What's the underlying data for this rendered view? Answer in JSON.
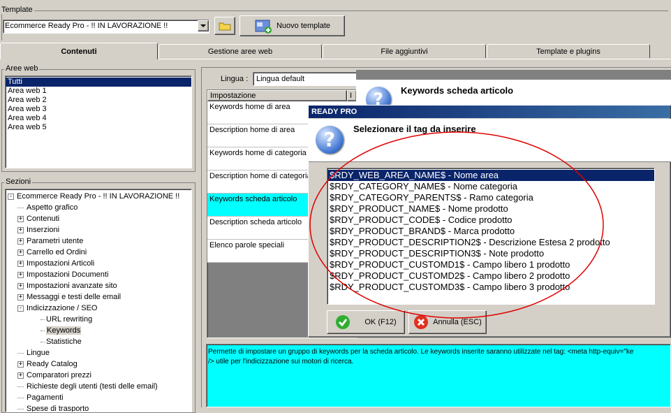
{
  "template_group": {
    "label": "Template",
    "selected": "Ecommerce Ready Pro - !! IN LAVORAZIONE !!",
    "new_button": "Nuovo template"
  },
  "tabs": [
    {
      "label": "Contenuti"
    },
    {
      "label": "Gestione aree web"
    },
    {
      "label": "File aggiuntivi"
    },
    {
      "label": "Template e plugins"
    }
  ],
  "aree_web": {
    "label": "Aree web",
    "items": [
      "Tutti",
      "Area web 1",
      "Area web 2",
      "Area web 3",
      "Area web 4",
      "Area web 5"
    ]
  },
  "sezioni": {
    "label": "Sezioni",
    "root": "Ecommerce Ready Pro - !! IN LAVORAZIONE !!",
    "items": [
      {
        "label": "Aspetto grafico",
        "expander": ""
      },
      {
        "label": "Contenuti",
        "expander": "+"
      },
      {
        "label": "Inserzioni",
        "expander": "+"
      },
      {
        "label": "Parametri utente",
        "expander": "+"
      },
      {
        "label": "Carrello ed Ordini",
        "expander": "+"
      },
      {
        "label": "Impostazioni Articoli",
        "expander": "+"
      },
      {
        "label": "Impostazioni Documenti",
        "expander": "+"
      },
      {
        "label": "Impostazioni avanzate sito",
        "expander": "+"
      },
      {
        "label": "Messaggi e testi delle email",
        "expander": "+"
      },
      {
        "label": "Indicizzazione / SEO",
        "expander": "-"
      },
      {
        "label": "URL rewriting",
        "expander": "child"
      },
      {
        "label": "Keywords",
        "expander": "child"
      },
      {
        "label": "Statistiche",
        "expander": "child"
      },
      {
        "label": "Lingue",
        "expander": ""
      },
      {
        "label": "Ready Catalog",
        "expander": "+"
      },
      {
        "label": "Comparatori prezzi",
        "expander": "+"
      },
      {
        "label": "Richieste degli utenti (testi delle email)",
        "expander": ""
      },
      {
        "label": "Pagamenti",
        "expander": ""
      },
      {
        "label": "Spese di trasporto",
        "expander": ""
      }
    ]
  },
  "main": {
    "lingua_label": "Lingua :",
    "lingua_value": "Lingua default",
    "grid_header": "Impostazione",
    "grid_header2": "I",
    "rows": [
      "Keywords home di area",
      "Description home di area",
      "Keywords home di categoria",
      "Description home di categoria",
      "Keywords scheda articolo",
      "Description scheda articolo",
      "Elenco parole speciali"
    ],
    "description": "Permette di impostare un gruppo di keywords per la scheda articolo. Le keywords inserite saranno utilizzate nel tag: <meta http-equiv=\"ke",
    "description2": "/> utile per l'indicizzazione sui motori di ricerca."
  },
  "back_dialog": {
    "title": "Keywords scheda articolo"
  },
  "dialog": {
    "title": "READY PRO",
    "heading": "Selezionare il tag da inserire",
    "tags": [
      "$RDY_WEB_AREA_NAME$ - Nome area",
      "$RDY_CATEGORY_NAME$ - Nome categoria",
      "$RDY_CATEGORY_PARENTS$ - Ramo categoria",
      "$RDY_PRODUCT_NAME$ - Nome prodotto",
      "$RDY_PRODUCT_CODE$ - Codice prodotto",
      "$RDY_PRODUCT_BRAND$ - Marca prodotto",
      "$RDY_PRODUCT_DESCRIPTION2$ - Descrizione Estesa 2 prodotto",
      "$RDY_PRODUCT_DESCRIPTION3$ - Note prodotto",
      "$RDY_PRODUCT_CUSTOMD1$ - Campo libero 1 prodotto",
      "$RDY_PRODUCT_CUSTOMD2$ - Campo libero 2 prodotto",
      "$RDY_PRODUCT_CUSTOMD3$ - Campo libero 3 prodotto"
    ],
    "ok_label": "OK (F12)",
    "cancel_label": "Annulla (ESC)"
  },
  "colors": {
    "selection": "#0a246a",
    "highlight_cell": "#00ffff",
    "annotation_ellipse": "#e00000"
  },
  "icons": [
    "folder-icon",
    "new-template-icon",
    "question-icon",
    "ok-check-icon",
    "cancel-x-icon"
  ]
}
